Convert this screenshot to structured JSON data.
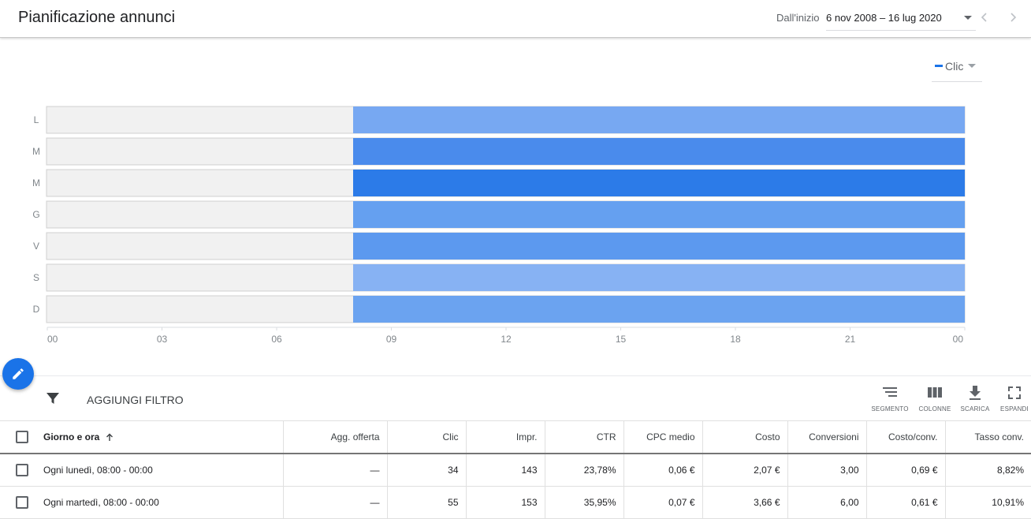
{
  "header": {
    "title": "Pianificazione annunci",
    "date_prefix": "Dall'inizio",
    "date_range": "6 nov 2008 – 16 lug 2020"
  },
  "metric_selector": {
    "label": "Clic",
    "color": "#1a73e8"
  },
  "chart_data": {
    "type": "heatmap",
    "metric": "Clic",
    "rows": [
      "L",
      "M",
      "M",
      "G",
      "V",
      "S",
      "D"
    ],
    "x_ticks": [
      "00",
      "03",
      "06",
      "09",
      "12",
      "15",
      "18",
      "21",
      "00"
    ],
    "x_range_hours": [
      0,
      24
    ],
    "active_window": {
      "start": 8,
      "end": 24
    },
    "values": [
      34,
      55,
      74,
      45,
      50,
      28,
      40
    ],
    "inactive_color": "#f1f1f1",
    "colors": [
      "#77a8f2",
      "#4a8bec",
      "#2c7be8",
      "#65a0f0",
      "#5c99ef",
      "#87b2f3",
      "#6ba3f0"
    ]
  },
  "toolbar": {
    "add_filter": "AGGIUNGI FILTRO",
    "segment": "SEGMENTO",
    "columns": "COLONNE",
    "download": "SCARICA",
    "expand": "ESPANDI"
  },
  "table": {
    "headers": [
      "Giorno e ora",
      "Agg. offerta",
      "Clic",
      "Impr.",
      "CTR",
      "CPC medio",
      "Costo",
      "Conversioni",
      "Costo/conv.",
      "Tasso conv."
    ],
    "rows": [
      [
        "Ogni lunedì, 08:00 - 00:00",
        "—",
        "34",
        "143",
        "23,78%",
        "0,06 €",
        "2,07 €",
        "3,00",
        "0,69 €",
        "8,82%"
      ],
      [
        "Ogni martedì, 08:00 - 00:00",
        "—",
        "55",
        "153",
        "35,95%",
        "0,07 €",
        "3,66 €",
        "6,00",
        "0,61 €",
        "10,91%"
      ]
    ]
  }
}
